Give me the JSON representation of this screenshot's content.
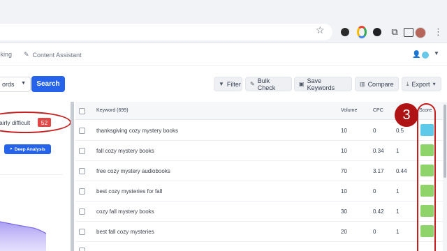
{
  "browser": {
    "icons": [
      "star-icon",
      "account-icon",
      "flower-icon",
      "chart-icon",
      "puzzle-icon",
      "sidebar-icon",
      "avatar",
      "kebab-icon"
    ]
  },
  "nav": {
    "tracking_label": "cking",
    "content_assistant_label": "Content Assistant"
  },
  "toolbar": {
    "database_value": "ords",
    "search_label": "Search",
    "filter_label": "Filter",
    "bulk_check_label": "Bulk Check",
    "save_keywords_label": "Save Keywords",
    "compare_label": "Compare",
    "export_label": "Export"
  },
  "difficulty": {
    "label": "airly difficult",
    "value": "52",
    "deep_analysis_label": "Deep Analysis"
  },
  "annotation": {
    "number": "3",
    "color": "#c41e1e"
  },
  "table": {
    "headers": {
      "keyword": "Keyword (699)",
      "volume": "Volume",
      "cpc": "CPC",
      "score": "Score"
    },
    "rows": [
      {
        "keyword": "thanksgiving cozy mystery books",
        "volume": "10",
        "cpc": "0",
        "competition": "0.5",
        "score_color": "#5ec9e8"
      },
      {
        "keyword": "fall cozy mystery books",
        "volume": "10",
        "cpc": "0.34",
        "competition": "1",
        "score_color": "#8fd36b"
      },
      {
        "keyword": "free cozy mystery audiobooks",
        "volume": "70",
        "cpc": "3.17",
        "competition": "0.44",
        "score_color": "#8fd36b"
      },
      {
        "keyword": "best cozy mysteries for fall",
        "volume": "10",
        "cpc": "0",
        "competition": "1",
        "score_color": "#8fd36b"
      },
      {
        "keyword": "cozy fall mystery books",
        "volume": "30",
        "cpc": "0.42",
        "competition": "1",
        "score_color": "#8fd36b"
      },
      {
        "keyword": "best fall cozy mysteries",
        "volume": "20",
        "cpc": "0",
        "competition": "1",
        "score_color": "#8fd36b"
      }
    ]
  }
}
